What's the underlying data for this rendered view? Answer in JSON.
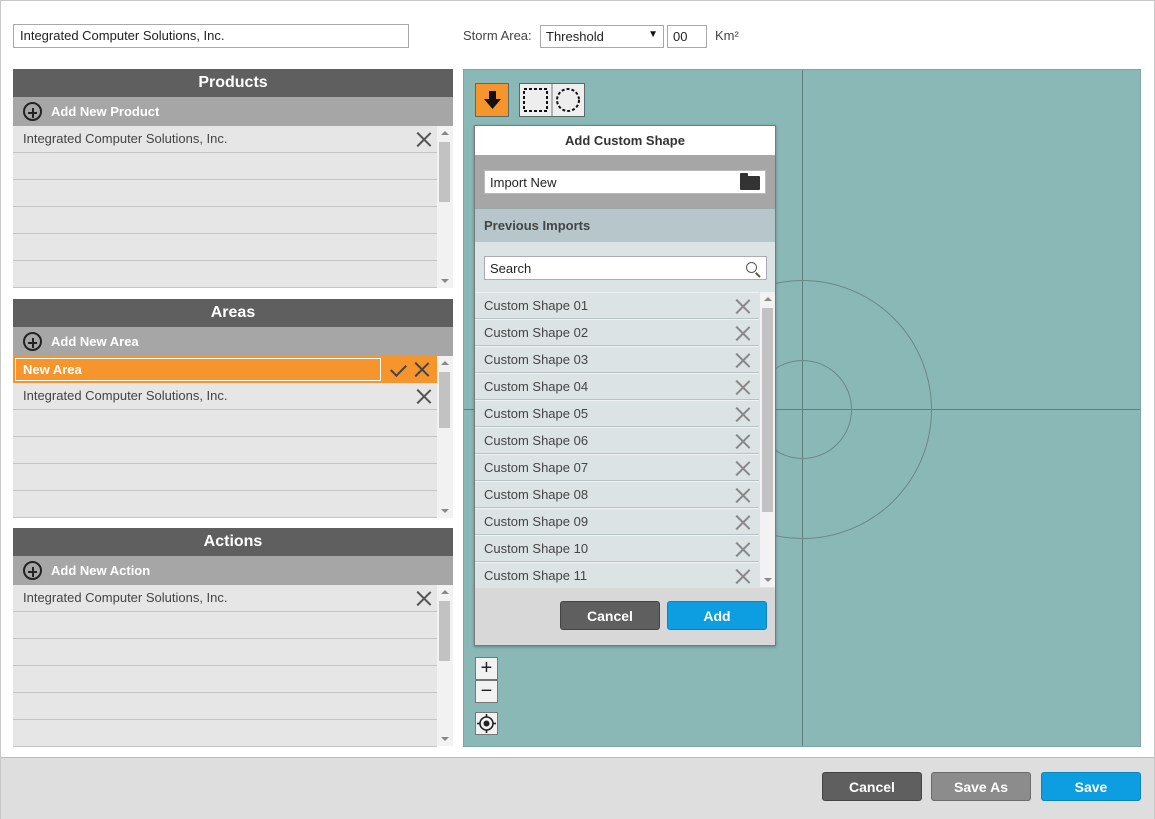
{
  "header": {
    "name_value": "Integrated Computer Solutions, Inc.",
    "storm_area_label": "Storm Area:",
    "storm_select_value": "Threshold",
    "storm_select_arrow": "▼",
    "storm_number": "00",
    "storm_unit": "Km²"
  },
  "products": {
    "title": "Products",
    "add_label": "Add New Product",
    "rows": [
      "Integrated Computer Solutions, Inc.",
      "",
      "",
      "",
      "",
      ""
    ]
  },
  "areas": {
    "title": "Areas",
    "add_label": "Add New Area",
    "editing_row": "New Area",
    "rows": [
      "Integrated Computer Solutions, Inc.",
      "",
      "",
      "",
      ""
    ]
  },
  "actions": {
    "title": "Actions",
    "add_label": "Add New Action",
    "rows": [
      "Integrated Computer Solutions, Inc.",
      "",
      "",
      "",
      "",
      ""
    ]
  },
  "map": {
    "zoom_in": "+",
    "zoom_out": "−",
    "background_color": "#8ab8b6"
  },
  "dialog": {
    "title": "Add Custom Shape",
    "import_placeholder": "Import New",
    "previous_imports_label": "Previous Imports",
    "search_placeholder": "Search",
    "shapes": [
      "Custom Shape 01",
      "Custom Shape 02",
      "Custom Shape 03",
      "Custom Shape 04",
      "Custom Shape 05",
      "Custom Shape 06",
      "Custom Shape 07",
      "Custom Shape 08",
      "Custom Shape 09",
      "Custom Shape 10",
      "Custom Shape 11"
    ],
    "cancel_label": "Cancel",
    "add_label": "Add"
  },
  "footer": {
    "cancel_label": "Cancel",
    "save_as_label": "Save As",
    "save_label": "Save"
  },
  "colors": {
    "accent_orange": "#f7952d",
    "primary_blue": "#0c9ee0",
    "panel_header": "#5f5f5f"
  }
}
